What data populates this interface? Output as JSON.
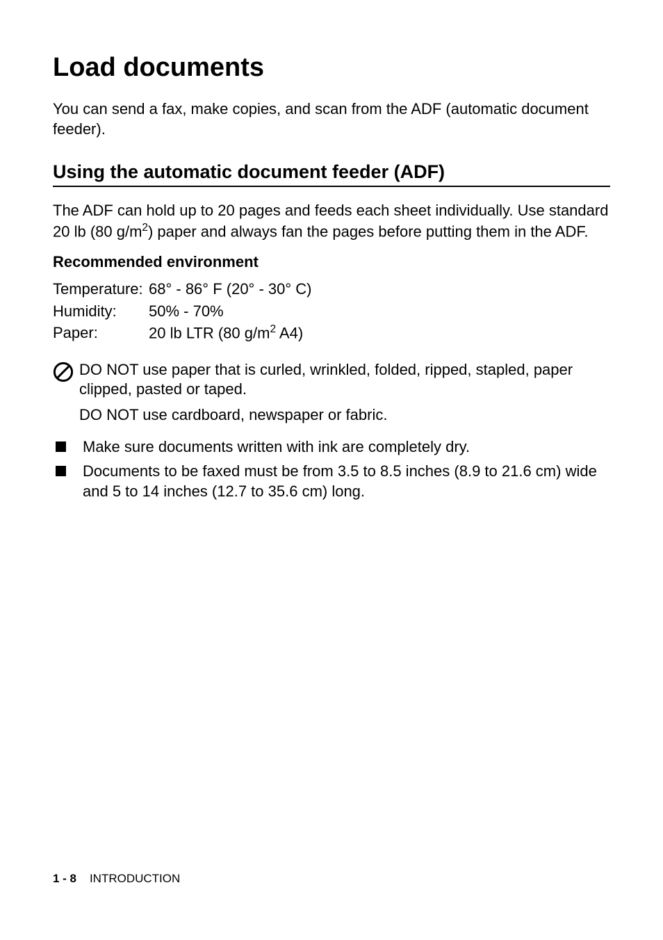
{
  "heading": "Load documents",
  "intro": "You can send a fax, make copies, and scan from the ADF (automatic document feeder).",
  "subheading": "Using the automatic document feeder (ADF)",
  "adf_desc_pre": "The ADF can hold up to 20 pages and feeds each sheet individually. Use standard 20 lb (80 g/m",
  "adf_desc_sup": "2",
  "adf_desc_post": ") paper and always fan the pages before putting them in the ADF.",
  "env_heading": "Recommended environment",
  "env": {
    "temperature": {
      "label": "Temperature:",
      "value": "68° - 86° F (20° - 30° C)"
    },
    "humidity": {
      "label": "Humidity:",
      "value": "50% - 70%"
    },
    "paper": {
      "label": "Paper:",
      "value_pre": "20 lb LTR (80 g/m",
      "value_sup": "2",
      "value_post": " A4)"
    }
  },
  "prohibit": {
    "line1": "DO NOT use paper that is curled, wrinkled, folded, ripped, stapled, paper clipped, pasted or taped.",
    "line2": "DO NOT use cardboard, newspaper or fabric."
  },
  "bullets": [
    "Make sure documents written with ink are completely dry.",
    "Documents to be faxed must be from 3.5 to 8.5 inches (8.9 to 21.6 cm) wide and 5 to 14 inches (12.7 to 35.6 cm) long."
  ],
  "footer": {
    "page": "1 - 8",
    "section": "INTRODUCTION"
  }
}
